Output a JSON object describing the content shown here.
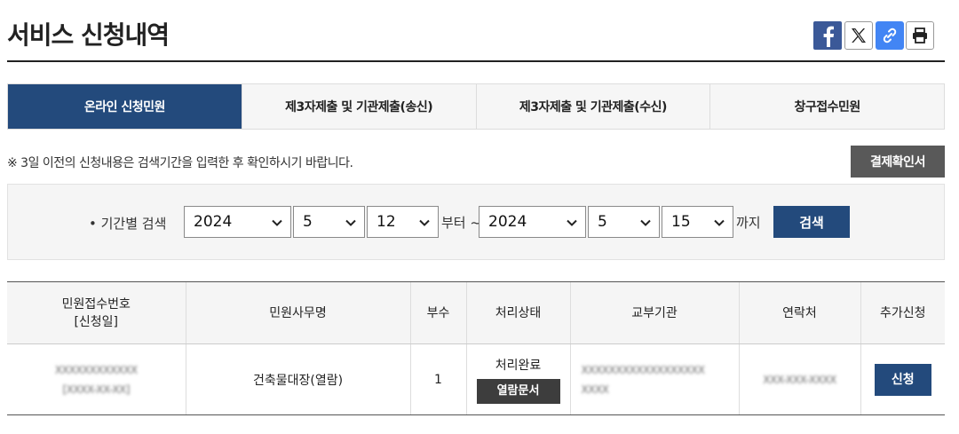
{
  "page": {
    "title": "서비스 신청내역"
  },
  "share": {
    "icons": [
      "facebook-icon",
      "x-icon",
      "link-icon",
      "print-icon"
    ],
    "facebook_color": "#3b5998",
    "link_color": "#4285f4"
  },
  "tabs": [
    {
      "label": "온라인 신청민원",
      "active": true
    },
    {
      "label": "제3자제출 및 기관제출(송신)",
      "active": false
    },
    {
      "label": "제3자제출 및 기관제출(수신)",
      "active": false
    },
    {
      "label": "창구접수민원",
      "active": false
    }
  ],
  "notice": "※ 3일 이전의 신청내용은 검색기간을 입력한 후 확인하시기 바랍니다.",
  "receipt_button": "결제확인서",
  "search": {
    "label": "• 기간별 검색",
    "from": {
      "year": "2024",
      "month": "5",
      "day": "12"
    },
    "from_suffix": "부터 ~",
    "to": {
      "year": "2024",
      "month": "5",
      "day": "15"
    },
    "to_suffix": "까지",
    "button": "검색"
  },
  "table": {
    "headers": [
      "민원접수번호",
      "[신청일]",
      "민원사무명",
      "부수",
      "처리상태",
      "교부기관",
      "연락처",
      "추가신청"
    ],
    "rows": [
      {
        "receipt_no": "XXXXXXXXXXXX",
        "date": "[XXXX-XX-XX]",
        "service": "건축물대장(열람)",
        "copies": "1",
        "status": "처리완료",
        "view_button": "열람문서",
        "agency_line1": "XXXXXXXXXXXXXXXXXX",
        "agency_line2": "XXXX",
        "contact": "XXX-XXX-XXXX",
        "apply_button": "신청"
      }
    ]
  },
  "colors": {
    "primary": "#234a7c",
    "dark_button": "#595959",
    "view_button": "#3d3d3d"
  }
}
